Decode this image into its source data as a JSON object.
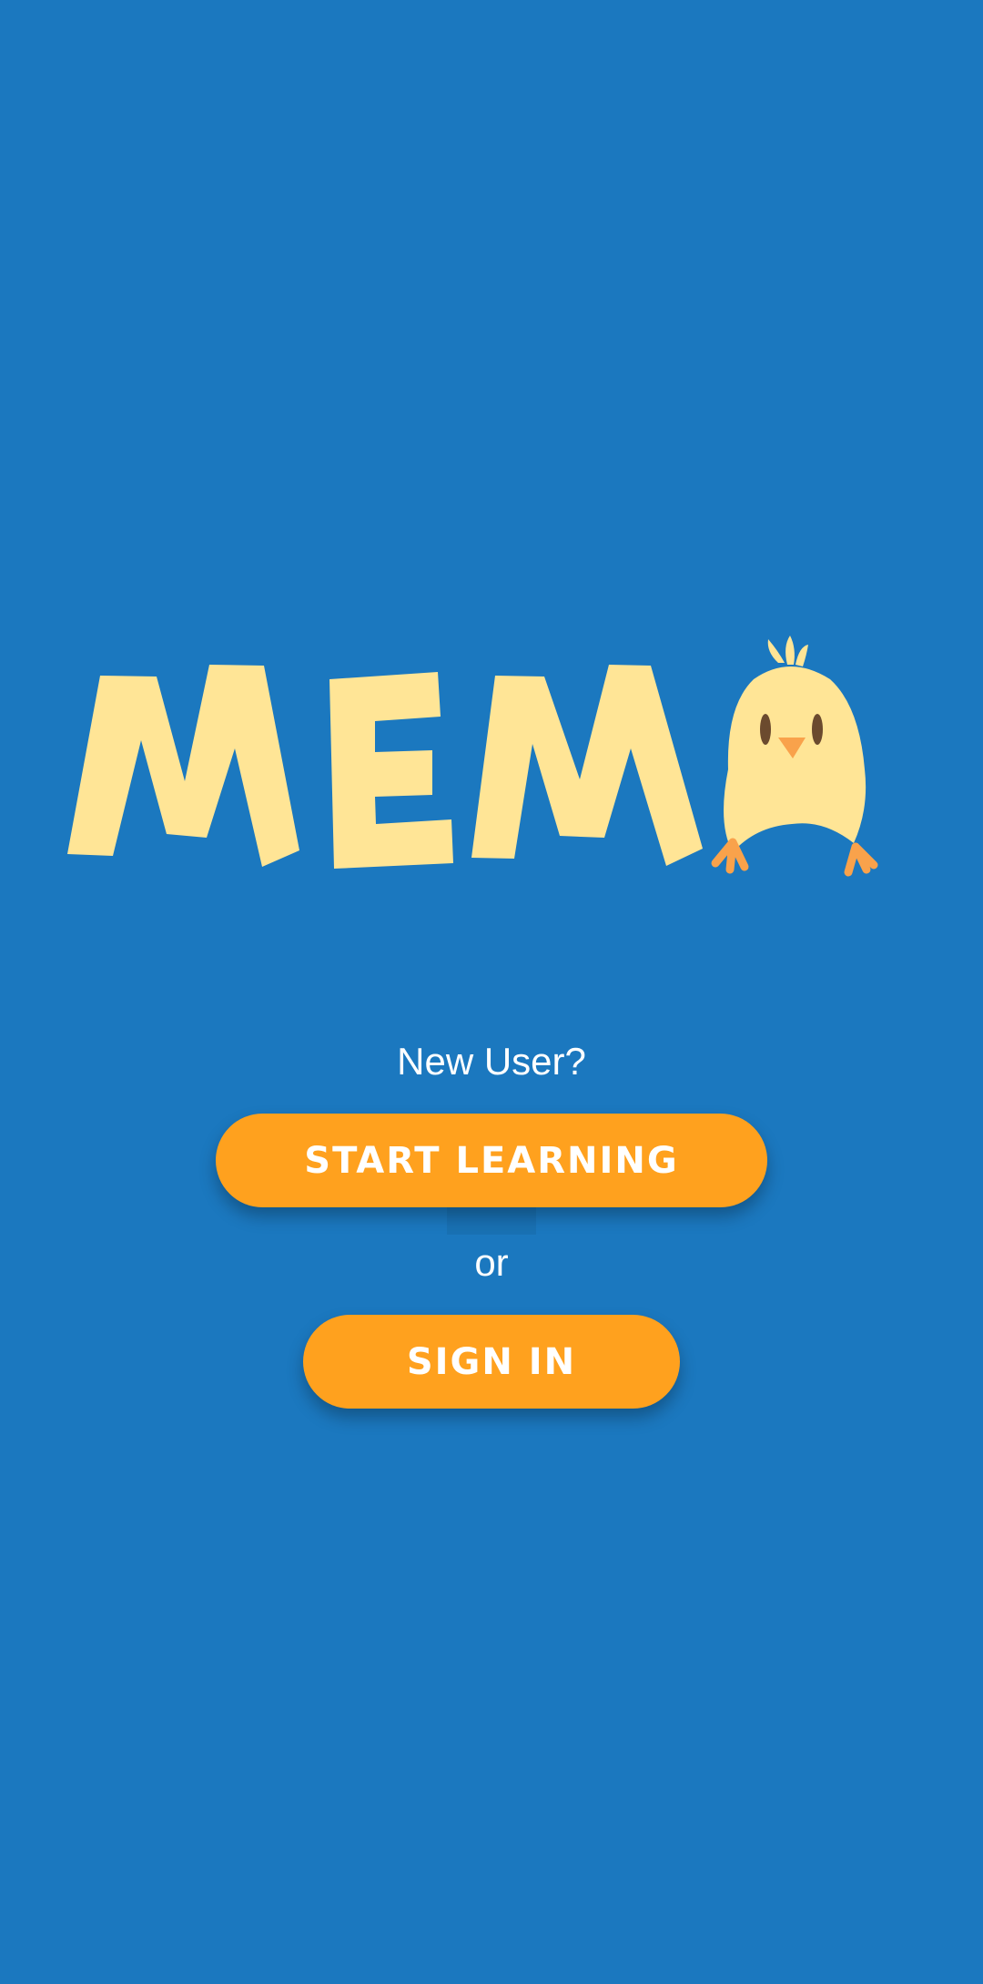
{
  "app": {
    "logo_text": "MEMO"
  },
  "welcome": {
    "new_user_prompt": "New User?",
    "start_button_label": "START LEARNING",
    "or_separator": "or",
    "signin_button_label": "SIGN IN"
  },
  "colors": {
    "background": "#1B78BF",
    "logo_yellow": "#FFE596",
    "button_orange": "#FFA11E",
    "chick_feet": "#F9A24B",
    "chick_eye": "#6B4A2E"
  },
  "icons": {
    "mascot": "chick-mascot-icon"
  }
}
